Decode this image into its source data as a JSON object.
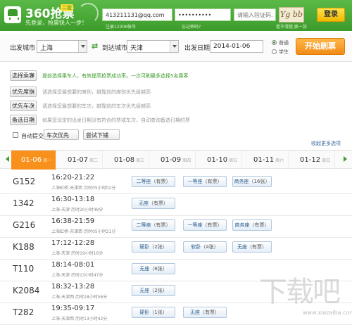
{
  "header": {
    "app_title": "360抢票",
    "badge": "二版",
    "slogan": "先登录，抢票快人一步！",
    "username": "413211131@qq.com",
    "username_hint": "注册12306帐号",
    "password": "••••••••••",
    "password_hint": "忘记密码?",
    "captcha_placeholder": "请输入验证码..",
    "captcha_text": "Yg bb",
    "captcha_hint": "看不清楚,换一张",
    "login_label": "登录"
  },
  "search": {
    "from_label": "出发城市",
    "from_city": "上海",
    "to_label": "到达城市",
    "to_city": "天津",
    "date_label": "出发日期",
    "date_value": "2014-01-06",
    "type_normal": "普通",
    "type_student": "学生",
    "brush_label": "开始刷票"
  },
  "options": {
    "passenger_btn": "选择乘客",
    "passenger_hint": "提前选择乘车人，有效提高抢票成功率。一次可刷最多选择5名乘客",
    "seat_btn": "优先席别",
    "seat_hint": "请选择您最想要的席别，越靠前的席别优先级越高",
    "train_btn": "优先车次",
    "train_hint": "请选择您最想要的车次，越靠前的车次优先级越高",
    "date_btn": "备选日期",
    "date_hint": "如果您设定的出发日期没有符合的票或车次，自动查询备选日期的票",
    "auto_submit": "自动提交",
    "auto_select": "车次优先",
    "fail_select": "尝试下铺",
    "more_link": "收起更多选项"
  },
  "dates": [
    {
      "date": "01-06",
      "weekday": "周一"
    },
    {
      "date": "01-07",
      "weekday": "周二"
    },
    {
      "date": "01-08",
      "weekday": "周三"
    },
    {
      "date": "01-09",
      "weekday": "周四"
    },
    {
      "date": "01-10",
      "weekday": "周五"
    },
    {
      "date": "01-11",
      "weekday": "周六"
    },
    {
      "date": "01-12",
      "weekday": "周日"
    }
  ],
  "trains": [
    {
      "no": "G152",
      "time": "16:20-21:22",
      "route": "上海虹桥-天津西 历时05小时02分",
      "seats": [
        {
          "name": "二等座",
          "avail": "有票"
        },
        {
          "name": "一等座",
          "avail": "有票"
        },
        {
          "name": "商务座",
          "avail": "16张"
        }
      ]
    },
    {
      "no": "1342",
      "time": "16:30-13:18",
      "route": "上海-天津 历时20小时48分",
      "seats": [
        {
          "name": "无座",
          "avail": "有票"
        }
      ]
    },
    {
      "no": "G216",
      "time": "16:38-21:59",
      "route": "上海虹桥-天津西 历时05小时21分",
      "seats": [
        {
          "name": "二等座",
          "avail": "有票"
        },
        {
          "name": "一等座",
          "avail": "有票"
        },
        {
          "name": "商务座",
          "avail": "有票"
        }
      ]
    },
    {
      "no": "K188",
      "time": "17:12-12:28",
      "route": "上海-天津 历时19小时16分",
      "seats": [
        {
          "name": "硬卧",
          "avail": "2张"
        },
        {
          "name": "软卧",
          "avail": "4张"
        },
        {
          "name": "无座",
          "avail": "有票"
        }
      ]
    },
    {
      "no": "T110",
      "time": "18:14-08:01",
      "route": "上海-天津 历时13小时47分",
      "seats": [
        {
          "name": "无座",
          "avail": "6张"
        }
      ]
    },
    {
      "no": "K2084",
      "time": "18:32-13:28",
      "route": "上海-天津西 历时18小时56分",
      "seats": [
        {
          "name": "无座",
          "avail": "2张"
        }
      ]
    },
    {
      "no": "T282",
      "time": "19:35-09:17",
      "route": "上海-天津西 历时13小时42分",
      "seats": [
        {
          "name": "硬卧",
          "avail": "1张"
        },
        {
          "name": "无座",
          "avail": "有票"
        }
      ]
    }
  ],
  "watermark": {
    "text": "下载吧",
    "sub": "www.xiazaiba.com"
  },
  "colors": {
    "brand_green": "#3d9b2c",
    "accent_orange": "#f7911b"
  }
}
